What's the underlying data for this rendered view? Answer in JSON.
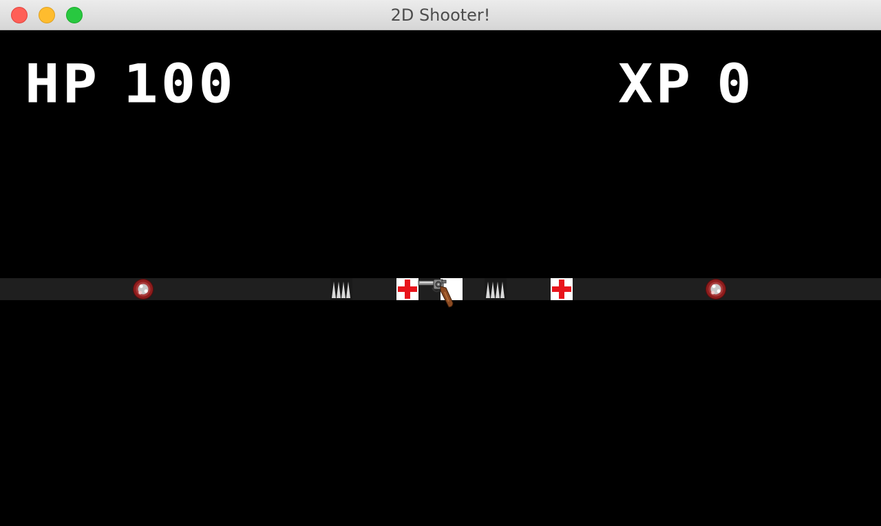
{
  "window": {
    "title": "2D Shooter!",
    "controls": [
      "close",
      "minimize",
      "maximize"
    ]
  },
  "hud": {
    "hp_label": "HP",
    "hp_value": "100",
    "xp_label": "XP",
    "xp_value": "0"
  },
  "track": {
    "items": [
      "virus",
      "spikes",
      "medkit",
      "player-revolver",
      "spikes",
      "medkit",
      "virus"
    ]
  },
  "colors": {
    "background": "#000000",
    "track": "#1f1f1f",
    "hud_text": "#ffffff",
    "medkit_cross": "#e8141b",
    "virus": "#8e1c1c"
  }
}
